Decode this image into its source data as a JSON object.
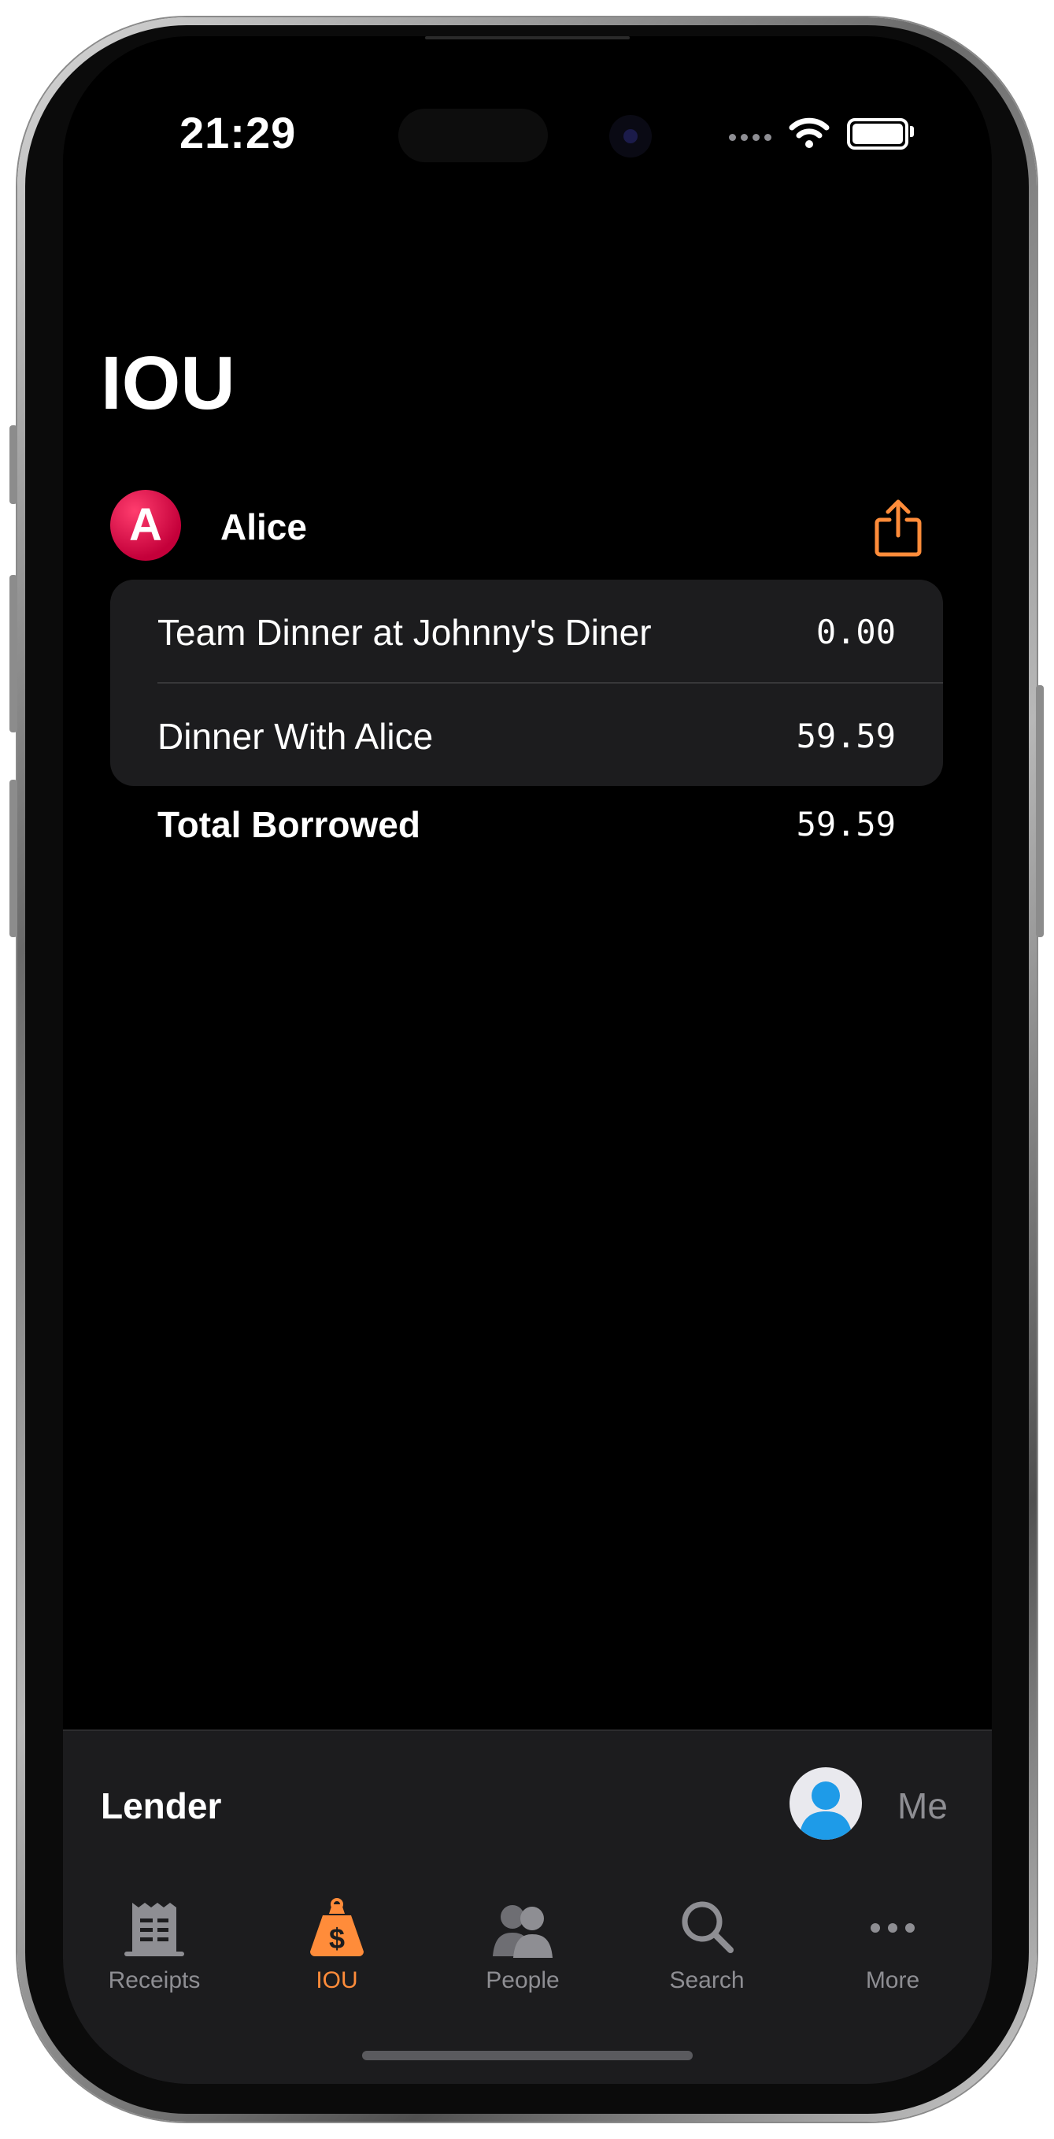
{
  "status_bar": {
    "time": "21:29"
  },
  "header": {
    "title": "IOU"
  },
  "person": {
    "initial": "A",
    "name": "Alice"
  },
  "items": [
    {
      "label": "Team Dinner at Johnny's Diner",
      "amount": "0.00"
    },
    {
      "label": "Dinner With Alice",
      "amount": "59.59"
    }
  ],
  "total": {
    "label": "Total Borrowed",
    "amount": "59.59"
  },
  "bottom": {
    "role_label": "Lender",
    "me_label": "Me"
  },
  "tabs": [
    {
      "label": "Receipts",
      "icon": "receipt-icon"
    },
    {
      "label": "IOU",
      "icon": "money-bag-icon"
    },
    {
      "label": "People",
      "icon": "people-icon"
    },
    {
      "label": "Search",
      "icon": "search-icon"
    },
    {
      "label": "More",
      "icon": "ellipsis-icon"
    }
  ],
  "colors": {
    "accent": "#ff8c3a",
    "avatar": "#e0104c",
    "background": "#000000",
    "card": "#1c1c1e"
  }
}
